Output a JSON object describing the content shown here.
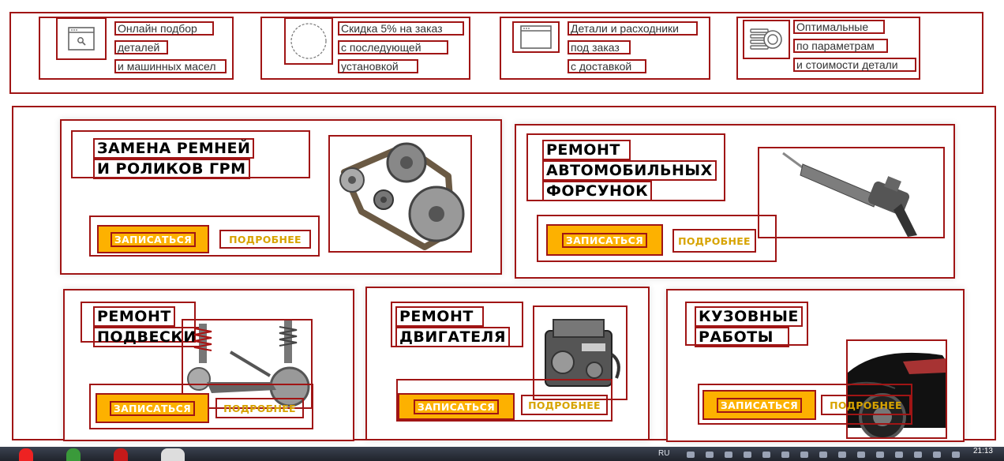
{
  "features": [
    {
      "icon": "search-window-icon",
      "lines": [
        "Онлайн подбор",
        "деталей",
        "и машинных масел"
      ]
    },
    {
      "icon": "percent-circle-icon",
      "lines": [
        "Скидка 5% на заказ",
        "с последующей",
        "установкой"
      ]
    },
    {
      "icon": "browser-window-icon",
      "lines": [
        "Детали и расходники",
        "под заказ",
        "с доставкой"
      ]
    },
    {
      "icon": "coins-icon",
      "lines": [
        "Оптимальные",
        "по параметрам",
        "и стоимости детали"
      ]
    }
  ],
  "services": [
    {
      "title_lines": [
        "ЗАМЕНА РЕМНЕЙ",
        "И РОЛИКОВ ГРМ"
      ],
      "image": "timing-belt-image"
    },
    {
      "title_lines": [
        "РЕМОНТ",
        "АВТОМОБИЛЬНЫХ",
        "ФОРСУНОК"
      ],
      "image": "injector-image"
    },
    {
      "title_lines": [
        "РЕМОНТ",
        "ПОДВЕСКИ"
      ],
      "image": "suspension-image"
    },
    {
      "title_lines": [
        "РЕМОНТ",
        "ДВИГАТЕЛЯ"
      ],
      "image": "engine-image"
    },
    {
      "title_lines": [
        "КУЗОВНЫЕ",
        "РАБОТЫ"
      ],
      "image": "car-body-image"
    }
  ],
  "buttons": {
    "signup": "ЗАПИСАТЬСЯ",
    "more": "ПОДРОБНЕЕ"
  },
  "colors": {
    "accent": "#fdb100",
    "more_text": "#d7a300",
    "annotation": "#a01515"
  },
  "taskbar": {
    "lang": "RU",
    "time": "21:13"
  }
}
